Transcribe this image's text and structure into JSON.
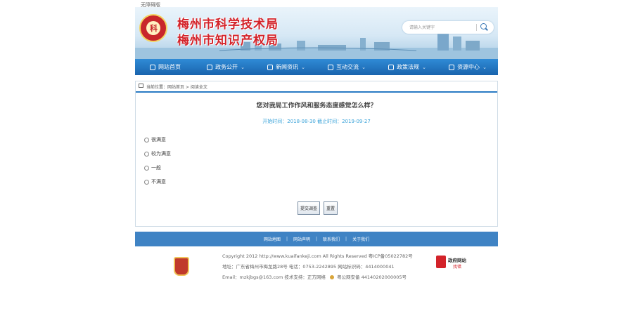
{
  "topbar": {
    "text": "无障碍版"
  },
  "header": {
    "title_line1": "梅州市科学技术局",
    "title_line2": "梅州市知识产权局",
    "search_placeholder": "请输入关键字"
  },
  "nav": {
    "items": [
      {
        "label": "网站首页",
        "icon": "home-icon",
        "has_dropdown": false
      },
      {
        "label": "政务公开",
        "icon": "document-icon",
        "has_dropdown": true
      },
      {
        "label": "新闻资讯",
        "icon": "monitor-icon",
        "has_dropdown": true
      },
      {
        "label": "互动交流",
        "icon": "chat-icon",
        "has_dropdown": true
      },
      {
        "label": "政策法规",
        "icon": "law-icon",
        "has_dropdown": true
      },
      {
        "label": "资源中心",
        "icon": "resource-icon",
        "has_dropdown": true
      }
    ],
    "dropdown_glyph": "⌄"
  },
  "breadcrumb": {
    "text": "当前位置：网站首页 > 阅读全文"
  },
  "survey": {
    "title": "您对我局工作作风和服务态度感觉怎么样？",
    "date_text": "开始时间：2018-08-30 截止时间：2019-09-27",
    "options": [
      "很满意",
      "较为满意",
      "一般",
      "不满意"
    ],
    "submit_label": "提交调查",
    "reset_label": "重置"
  },
  "footer_nav": {
    "items": [
      "网站地图",
      "网站声明",
      "联系我们",
      "关于我们"
    ],
    "separator": "|"
  },
  "footer": {
    "line1": "Copyright 2012 http://www.kuaifankeji.com All Rights Reserved    粤ICP备05022782号",
    "line2": "地址：广东省梅州市梅龙路28号    电话：0753-2242895    网站标识码：4414000041",
    "line3": "Email：mzkjbgs@163.com    技术支持：正方网络",
    "police": "粤公网安备 44140202000005号",
    "gov_label_1": "政府网站",
    "gov_label_2": "找错"
  },
  "colors": {
    "brand_red": "#d3232a",
    "nav_blue": "#1a64ad",
    "accent_blue": "#3aa3d9"
  }
}
